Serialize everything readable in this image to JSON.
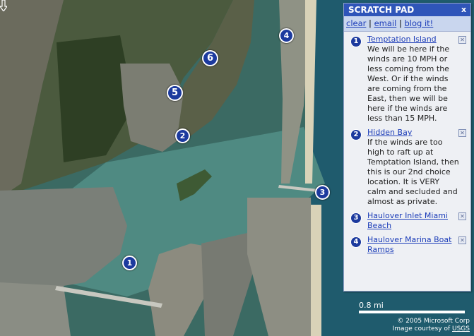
{
  "map": {
    "pins": [
      {
        "label": "1",
        "name": "pin-1"
      },
      {
        "label": "2",
        "name": "pin-2"
      },
      {
        "label": "3",
        "name": "pin-3"
      },
      {
        "label": "4",
        "name": "pin-4"
      },
      {
        "label": "5",
        "name": "pin-5"
      },
      {
        "label": "6",
        "name": "pin-6"
      }
    ],
    "scale_label": "0.8 mi",
    "copyright_line1": "© 2005 Microsoft Corp",
    "copyright_line2_prefix": "Image courtesy of ",
    "copyright_line2_link": "USGS"
  },
  "scratch_pad": {
    "title": "SCRATCH PAD",
    "close_label": "x",
    "links": {
      "clear": "clear",
      "sep1": "|",
      "email": "email",
      "sep2": "|",
      "blog": "blog it!"
    },
    "entries": [
      {
        "number": "1",
        "title": "Temptation Island",
        "description": "We will be here if the winds are 10 MPH or less coming from the West. Or if the winds are coming from the East, then we will be here if the winds are less than 15 MPH."
      },
      {
        "number": "2",
        "title": "Hidden Bay",
        "description": "If the winds are too high to raft up at Temptation Island, then this is our 2nd choice location. It is VERY calm and secluded and almost as private."
      },
      {
        "number": "3",
        "title": "Haulover Inlet Miami Beach",
        "description": ""
      },
      {
        "number": "4",
        "title": "Haulover Marina Boat Ramps",
        "description": ""
      }
    ],
    "delete_icon": "close-box-icon"
  }
}
